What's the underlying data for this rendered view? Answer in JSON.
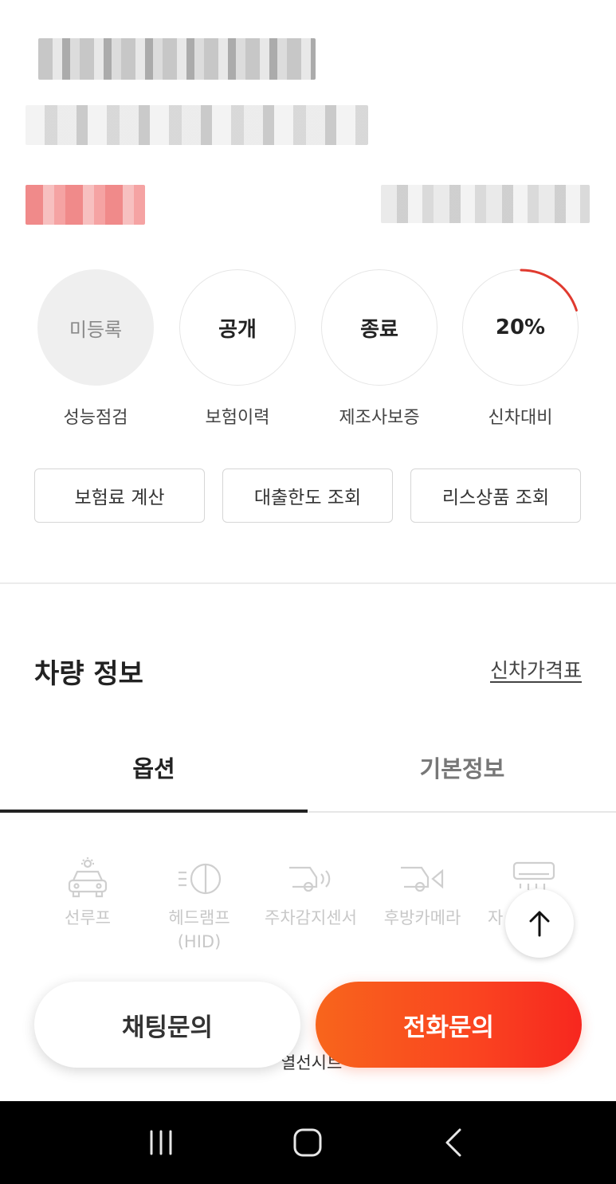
{
  "status_items": [
    {
      "value": "미등록",
      "label": "성능점검",
      "style": "grey"
    },
    {
      "value": "공개",
      "label": "보험이력",
      "style": "outline"
    },
    {
      "value": "종료",
      "label": "제조사보증",
      "style": "outline"
    },
    {
      "value": "20%",
      "label": "신차대비",
      "style": "progress",
      "progress": 0.2
    }
  ],
  "action_buttons": [
    {
      "label": "보험료 계산"
    },
    {
      "label": "대출한도 조회"
    },
    {
      "label": "리스상품 조회"
    }
  ],
  "vehicle_section": {
    "title": "차량 정보",
    "link": "신차가격표"
  },
  "tabs": [
    {
      "label": "옵션",
      "active": true
    },
    {
      "label": "기본정보",
      "active": false
    }
  ],
  "options": [
    {
      "label": "선루프",
      "icon": "sunroof-icon"
    },
    {
      "label": "헤드램프\n(HID)",
      "icon": "headlamp-icon"
    },
    {
      "label": "주차감지센서",
      "icon": "parking-sensor-icon"
    },
    {
      "label": "후방카메라",
      "icon": "rear-camera-icon"
    },
    {
      "label": "자",
      "icon": "air-conditioner-icon"
    }
  ],
  "options_row2": [
    "열선시트"
  ],
  "cta": {
    "chat": "채팅문의",
    "call": "전화문의"
  },
  "colors": {
    "accent": "#f7271f",
    "accent_start": "#f8651c",
    "progress_arc": "#e03a2f"
  }
}
